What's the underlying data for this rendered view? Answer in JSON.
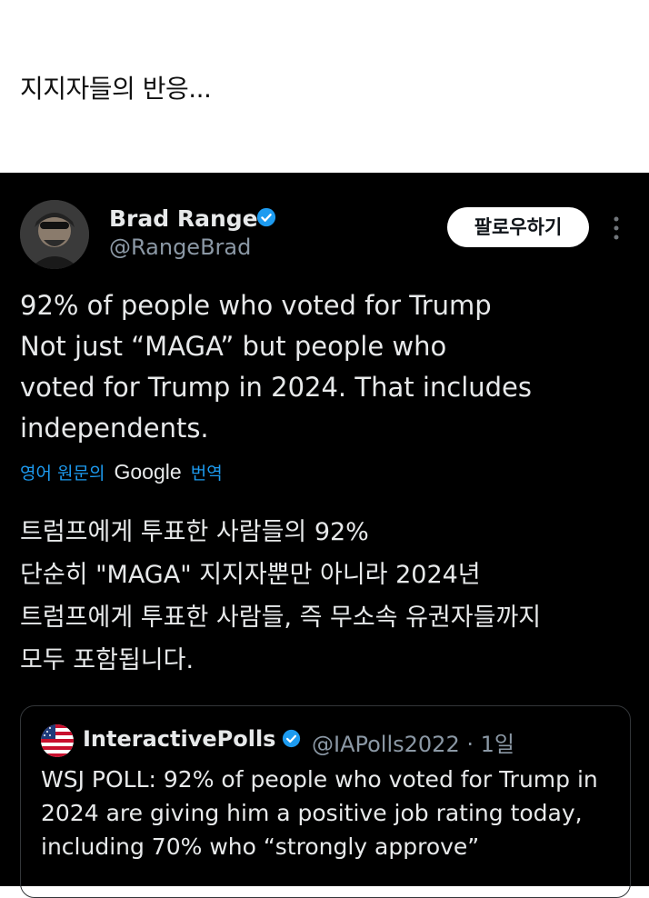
{
  "caption": "지지자들의 반응...",
  "tweet": {
    "author_name": "Brad Range",
    "handle": "@RangeBrad",
    "follow_label": "팔로우하기",
    "text": "92% of people who voted for Trump\nNot  just “MAGA”  but people who\nvoted for Trump in 2024.  That includes\nindependents.",
    "translate_prefix": "영어 원문의",
    "translate_brand": "Google",
    "translate_suffix": "번역",
    "translated_text": "트럼프에게 투표한 사람들의 92%\n단순히 \"MAGA\" 지지자뿐만 아니라 2024년\n트럼프에게 투표한 사람들, 즉 무소속 유권자들까지\n모두 포함됩니다."
  },
  "quote": {
    "author_name": "InteractivePolls",
    "handle_time": "@IAPolls2022 · 1일",
    "text": "WSJ POLL: 92% of people who voted for Trump in 2024 are giving him a positive job rating today, including 70% who “strongly approve”"
  },
  "colors": {
    "background": "#000000",
    "text": "#e7e9ea",
    "secondary": "#8b98a5",
    "link": "#1d9bf0",
    "verified": "#1d9bf0"
  },
  "icons": [
    "verified-badge-icon",
    "more-options-icon",
    "us-flag-icon"
  ]
}
